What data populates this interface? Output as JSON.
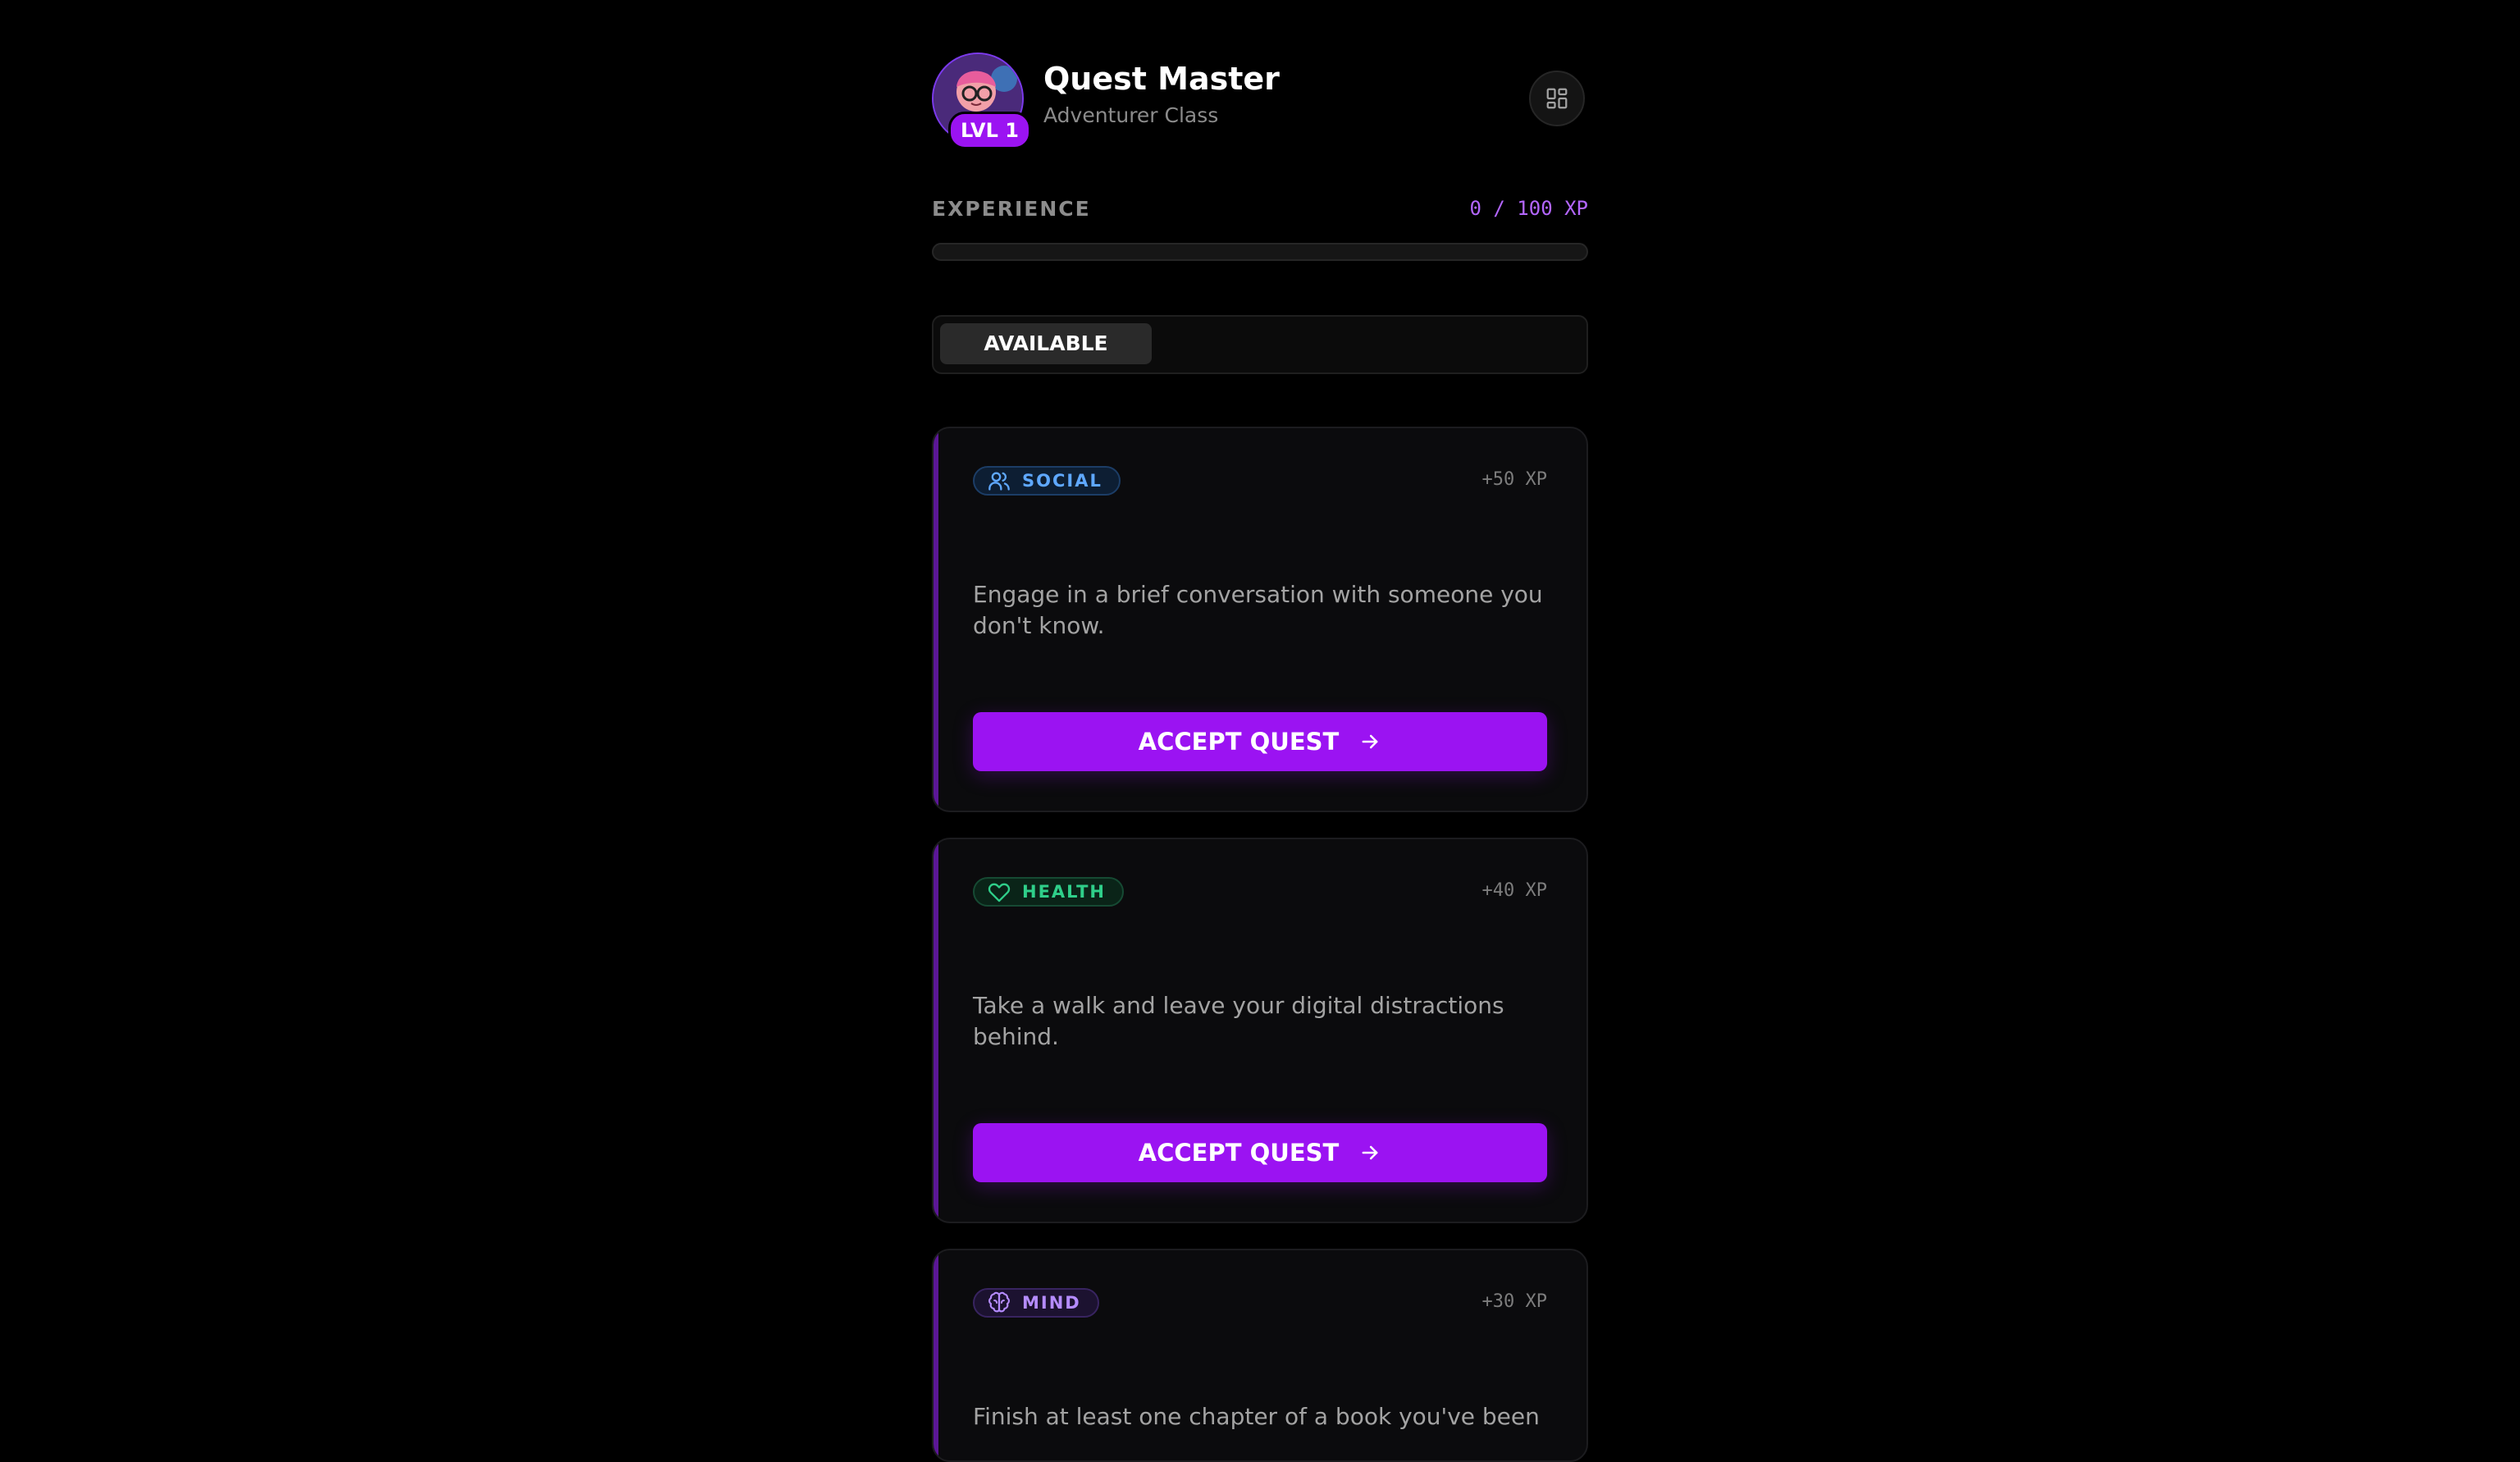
{
  "header": {
    "title": "Quest Master",
    "subtitle": "Adventurer Class",
    "level_badge": "LVL 1",
    "menu_icon": "grid-icon"
  },
  "experience": {
    "label": "EXPERIENCE",
    "value_text": "0 / 100 XP",
    "current": 0,
    "max": 100,
    "progress_fraction": 0
  },
  "tabs": {
    "active": "AVAILABLE"
  },
  "colors": {
    "accent": "#9b13f2",
    "background": "#000000",
    "card": "#0b0b0d",
    "social": "#5fa8ff",
    "health": "#2fcf8a",
    "mind": "#b58cff"
  },
  "quests": [
    {
      "category": "SOCIAL",
      "icon": "users-icon",
      "reward": "+50 XP",
      "description": "Engage in a brief conversation with someone you don't know.",
      "button": "ACCEPT QUEST"
    },
    {
      "category": "HEALTH",
      "icon": "heart-icon",
      "reward": "+40 XP",
      "description": "Take a walk and leave your digital distractions behind.",
      "button": "ACCEPT QUEST"
    },
    {
      "category": "MIND",
      "icon": "brain-icon",
      "reward": "+30 XP",
      "description": "Finish at least one chapter of a book you've been"
    }
  ]
}
